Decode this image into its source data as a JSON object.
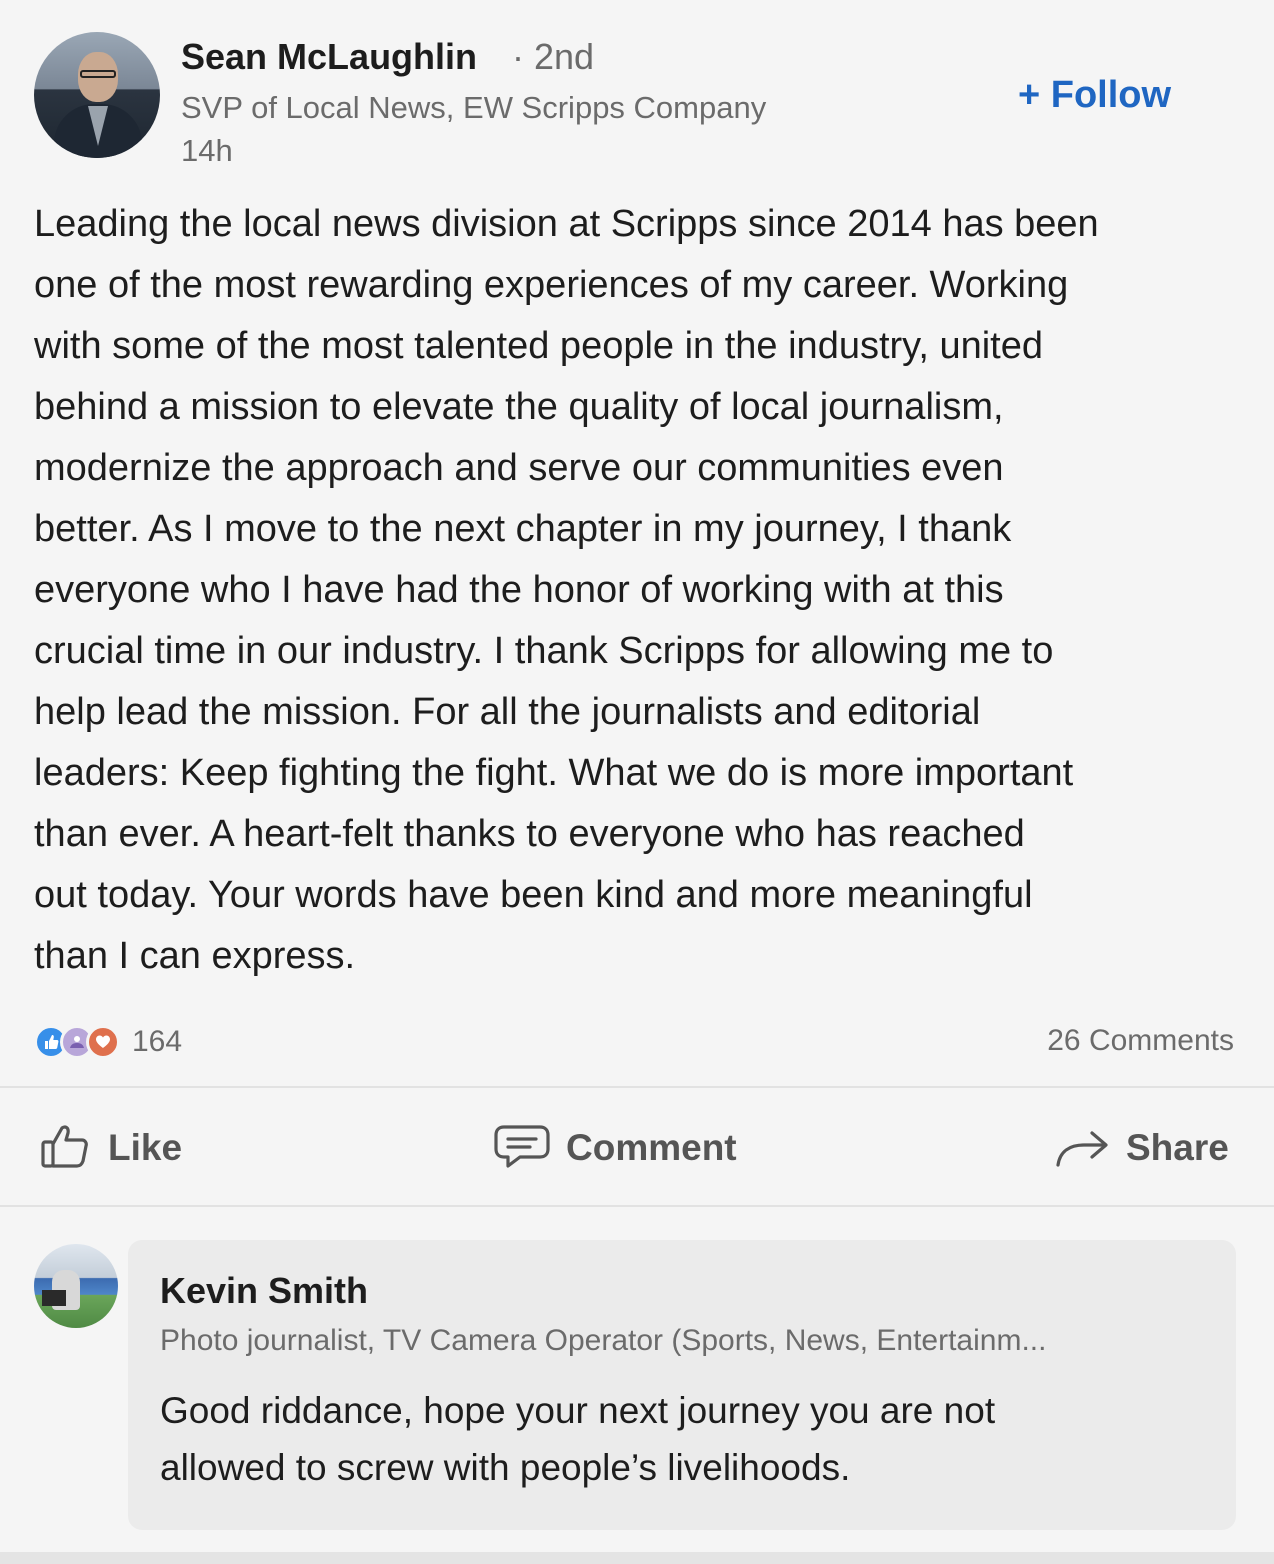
{
  "post": {
    "author": {
      "name": "Sean McLaughlin",
      "degree": "· 2nd",
      "title": "SVP of Local News, EW Scripps Company",
      "timestamp": "14h"
    },
    "follow_label": "+ Follow",
    "body_lines": [
      "Leading the local news division at Scripps since 2014 has been",
      "one of the most rewarding experiences of my career.  Working",
      "with some of the most talented people in the industry, united",
      "behind a mission to elevate the quality of local journalism,",
      "modernize the approach and serve our communities even",
      "better.  As I move to the next chapter in my journey, I thank",
      "everyone who I have had the honor of working with at this",
      "crucial time in our industry.   I thank Scripps for allowing me to",
      "help lead the mission.  For all the journalists and editorial",
      "leaders: Keep fighting the fight.  What we do is more important",
      "than ever.  A heart-felt thanks to everyone who has reached",
      "out today.  Your words have been kind and more meaningful",
      "than I can express."
    ],
    "reactions": {
      "count": "164",
      "icons": [
        "like-icon",
        "support-icon",
        "love-icon"
      ]
    },
    "comments_count": "26 Comments",
    "actions": {
      "like": "Like",
      "comment": "Comment",
      "share": "Share"
    }
  },
  "comment": {
    "author_name": "Kevin Smith",
    "author_title": "Photo journalist, TV Camera Operator (Sports, News, Entertainm...",
    "text_lines": [
      "Good riddance, hope your next journey you are not",
      "allowed to screw with people’s livelihoods."
    ]
  },
  "colors": {
    "accent": "#1f66c2",
    "background": "#f5f5f5",
    "comment_bubble": "#ebebeb",
    "muted_text": "#6b6b6b"
  }
}
